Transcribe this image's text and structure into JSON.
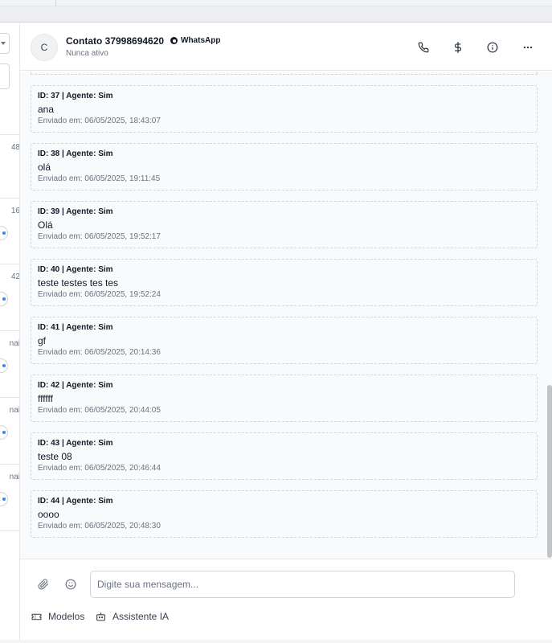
{
  "header": {
    "avatar_initial": "C",
    "contact_name": "Contato 37998694620",
    "channel": "WhatsApp",
    "status": "Nunca ativo",
    "icons": [
      "phone-icon",
      "dollar-icon",
      "info-icon",
      "more-icon"
    ]
  },
  "sidebar": {
    "items": [
      {
        "time": "48"
      },
      {
        "time": "16"
      },
      {
        "time": "42"
      },
      {
        "time": "nai"
      },
      {
        "time": "nai"
      },
      {
        "time": "nai"
      }
    ]
  },
  "messages": [
    {
      "meta": "ID: 37 | Agente: Sim",
      "text": "ana",
      "sent": "Enviado em: 06/05/2025, 18:43:07"
    },
    {
      "meta": "ID: 38 | Agente: Sim",
      "text": "olá",
      "sent": "Enviado em: 06/05/2025, 19:11:45"
    },
    {
      "meta": "ID: 39 | Agente: Sim",
      "text": "Olá",
      "sent": "Enviado em: 06/05/2025, 19:52:17"
    },
    {
      "meta": "ID: 40 | Agente: Sim",
      "text": "teste testes tes tes",
      "sent": "Enviado em: 06/05/2025, 19:52:24"
    },
    {
      "meta": "ID: 41 | Agente: Sim",
      "text": "gf",
      "sent": "Enviado em: 06/05/2025, 20:14:36"
    },
    {
      "meta": "ID: 42 | Agente: Sim",
      "text": "ffffff",
      "sent": "Enviado em: 06/05/2025, 20:44:05"
    },
    {
      "meta": "ID: 43 | Agente: Sim",
      "text": "teste 08",
      "sent": "Enviado em: 06/05/2025, 20:46:44"
    },
    {
      "meta": "ID: 44 | Agente: Sim",
      "text": "oooo",
      "sent": "Enviado em: 06/05/2025, 20:48:30"
    }
  ],
  "composer": {
    "placeholder": "Digite sua mensagem...",
    "value": "",
    "templates_label": "Modelos",
    "assistant_label": "Assistente IA"
  }
}
